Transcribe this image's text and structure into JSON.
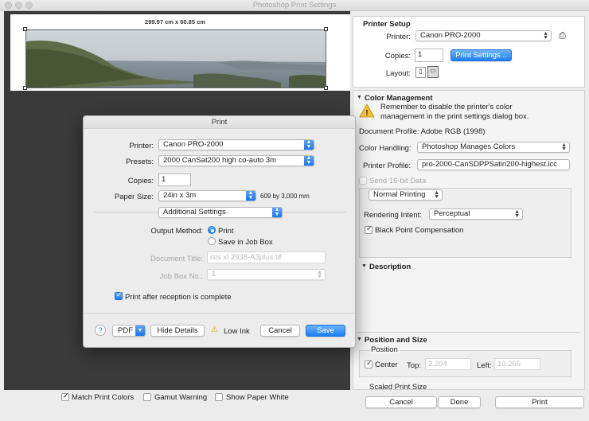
{
  "window": {
    "title": "Photoshop Print Settings"
  },
  "preview": {
    "dimension_label": "299.97 cm x 60.85 cm"
  },
  "printer_setup": {
    "heading": "Printer Setup",
    "printer_label": "Printer:",
    "printer_value": "Canon PRO-2000",
    "copies_label": "Copies:",
    "copies_value": "1",
    "print_settings_button": "Print Settings...",
    "layout_label": "Layout:"
  },
  "color_management": {
    "heading": "Color Management",
    "warning": "Remember to disable the printer's color management in the print settings dialog box.",
    "document_profile": "Document Profile: Adobe RGB (1998)",
    "color_handling_label": "Color Handling:",
    "color_handling_value": "Photoshop Manages Colors",
    "printer_profile_label": "Printer Profile:",
    "printer_profile_value": "pro-2000-CanSDPPSatin200-highest.icc",
    "send16_label": "Send 16-bit Data",
    "normal_printing": "Normal Printing",
    "rendering_intent_label": "Rendering Intent:",
    "rendering_intent_value": "Perceptual",
    "bpc_label": "Black Point Compensation"
  },
  "description": {
    "heading": "Description"
  },
  "position_size": {
    "heading": "Position and Size",
    "position_label": "Position",
    "center_label": "Center",
    "top_label": "Top:",
    "top_value": "2.204",
    "left_label": "Left:",
    "left_value": "10.265",
    "scaled_label": "Scaled Print Size"
  },
  "bottom_bar": {
    "match_print_colors": "Match Print Colors",
    "gamut_warning": "Gamut Warning",
    "show_paper_white": "Show Paper White",
    "cancel": "Cancel",
    "done": "Done",
    "print": "Print"
  },
  "print_dialog": {
    "title": "Print",
    "printer_label": "Printer:",
    "printer_value": "Canon PRO-2000",
    "presets_label": "Presets:",
    "presets_value": "2000 CanSat200 high co-auto 3m",
    "copies_label": "Copies:",
    "copies_value": "1",
    "paper_size_label": "Paper Size:",
    "paper_size_value": "24in x 3m",
    "paper_size_dims": "609 by 3,000 mm",
    "section_value": "Additional Settings",
    "output_method_label": "Output Method:",
    "output_print": "Print",
    "output_save": "Save in Job Box",
    "doc_title_label": "Document Title:",
    "doc_title_value": "isis xl 2938-A3plus.tif",
    "job_box_label": "Job Box No.:",
    "job_box_value": "1",
    "print_after_label": "Print after reception is complete",
    "help": "?",
    "pdf": "PDF",
    "hide_details": "Hide Details",
    "low_ink": "Low Ink",
    "cancel": "Cancel",
    "save": "Save"
  }
}
